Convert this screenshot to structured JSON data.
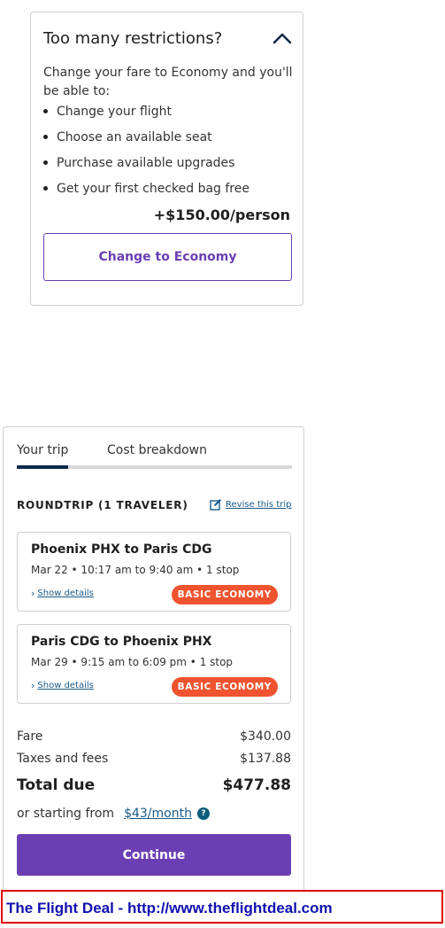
{
  "restrictions": {
    "title": "Too many restrictions?",
    "description": "Change your fare to Economy and you'll be able to:",
    "benefits": [
      "Change your flight",
      "Choose an available seat",
      "Purchase available upgrades",
      "Get your first checked bag free"
    ],
    "price": "+$150.00/person",
    "button_label": "Change to Economy",
    "collapse_icon": "chevron-up-icon"
  },
  "trip": {
    "tabs": [
      "Your trip",
      "Cost breakdown"
    ],
    "active_tab": "Your trip",
    "roundtrip_label": "ROUNDTRIP (1 TRAVELER)",
    "revise_label": "Revise this trip",
    "revise_icon": "edit-icon",
    "segments": [
      {
        "route": "Phoenix PHX to Paris CDG",
        "times": "Mar 22 • 10:17 am to 9:40 am • 1 stop",
        "details_label": "Show details",
        "fare_badge": "BASIC ECONOMY"
      },
      {
        "route": "Paris CDG to Phoenix PHX",
        "times": "Mar 29 • 9:15 am to 6:09 pm • 1 stop",
        "details_label": "Show details",
        "fare_badge": "BASIC ECONOMY"
      }
    ],
    "cost": {
      "fare_label": "Fare",
      "fare_value": "$340.00",
      "taxes_label": "Taxes and fees",
      "taxes_value": "$137.88",
      "total_label": "Total due",
      "total_value": "$477.88"
    },
    "starting_text": "or starting from",
    "monthly_price": "$43/month",
    "help_icon": "?",
    "continue_label": "Continue"
  },
  "watermark": {
    "text": "The Flight Deal - http://www.theflightdeal.com"
  },
  "colors": {
    "accent": "#6b3fb3",
    "badge": "#f0532f",
    "link": "#1a5a8a",
    "tab_active": "#0b2a4a",
    "watermark_border": "#e00000",
    "watermark_text": "#1010b0"
  }
}
